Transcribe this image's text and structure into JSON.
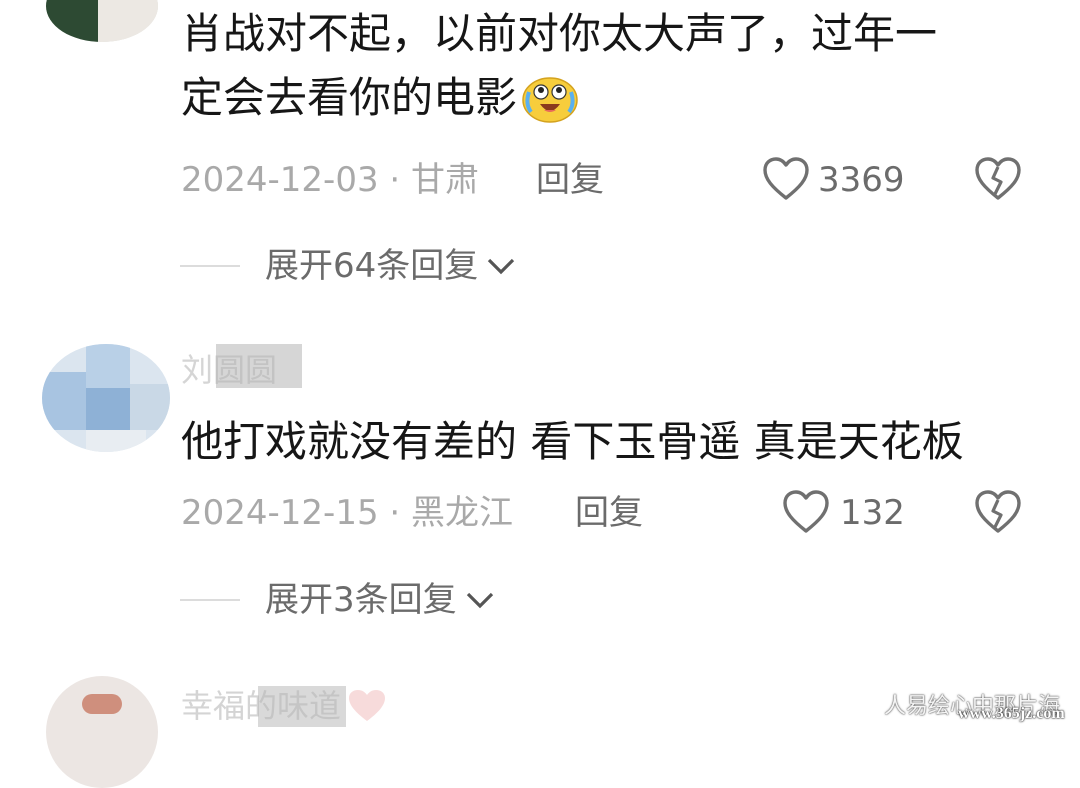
{
  "comments": [
    {
      "text_line1": "肖战对不起，以前对你太大声了，过年一",
      "text_line2": "定会去看你的电影",
      "date": "2024-12-03 · 甘肃",
      "reply": "回复",
      "likes": "3369",
      "expand": "展开64条回复"
    },
    {
      "username": "刘圆圆",
      "text_line1": "他打戏就没有差的 看下玉骨遥 真是天花板",
      "date": "2024-12-15 · 黑龙江",
      "reply": "回复",
      "likes": "132",
      "expand": "展开3条回复"
    },
    {
      "username": "幸福的味道"
    }
  ],
  "watermark": {
    "line1": "人易绘心中那片海",
    "line2": "www.365jz.com"
  },
  "icons": {
    "emoji": "crying-laughing-emoji-icon",
    "like": "heart-outline-icon",
    "dislike": "broken-heart-icon",
    "expand": "chevron-down-icon"
  }
}
